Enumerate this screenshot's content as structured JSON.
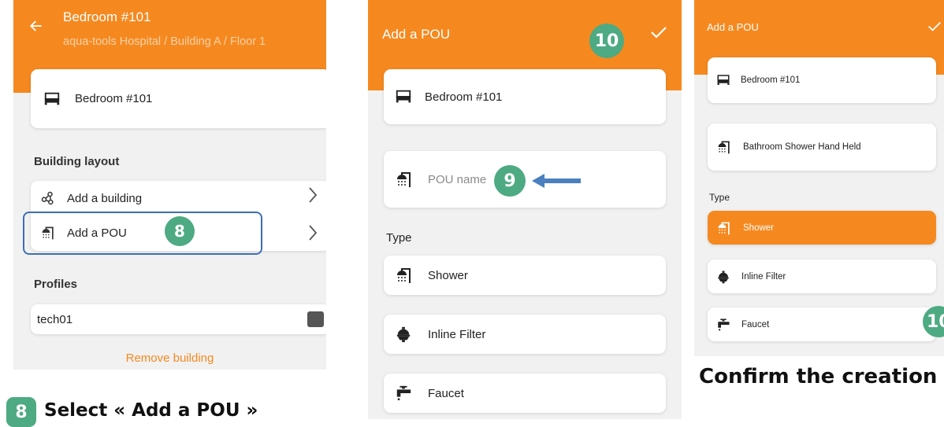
{
  "screen1": {
    "title": "Bedroom #101",
    "breadcrumb": "aqua-tools Hospital / Building A / Floor 1",
    "room_card_label": "Bedroom #101",
    "section_building_layout": "Building layout",
    "add_building_label": "Add a building",
    "add_pou_label": "Add a POU",
    "section_profiles": "Profiles",
    "profile_label": "tech01",
    "remove_building_label": "Remove building"
  },
  "screen2": {
    "title": "Add a POU",
    "room_card_label": "Bedroom #101",
    "pou_name_placeholder": "POU name",
    "section_type": "Type",
    "types": [
      "Shower",
      "Inline Filter",
      "Faucet"
    ]
  },
  "screen3": {
    "title": "Add a POU",
    "room_card_label": "Bedroom #101",
    "pou_name_value": "Bathroom Shower Hand Held",
    "section_type": "Type",
    "types": [
      "Shower",
      "Inline Filter",
      "Faucet"
    ],
    "selected_type": "Shower"
  },
  "badges": {
    "step8": "8",
    "step9": "9",
    "step10": "10"
  },
  "captions": {
    "step8": "Select « Add a POU »",
    "step10": "Confirm the creation"
  },
  "colors": {
    "accent_orange": "#f5891f",
    "badge_green": "#4daa82",
    "highlight_blue": "#3d6fb0",
    "arrow_blue": "#4a7fc0",
    "panel_bg": "#f1f1f1"
  },
  "icons": [
    "back-arrow-icon",
    "check-icon",
    "bed-icon",
    "shower-icon",
    "building-network-icon",
    "inline-filter-icon",
    "faucet-icon",
    "chevron-right-icon"
  ]
}
